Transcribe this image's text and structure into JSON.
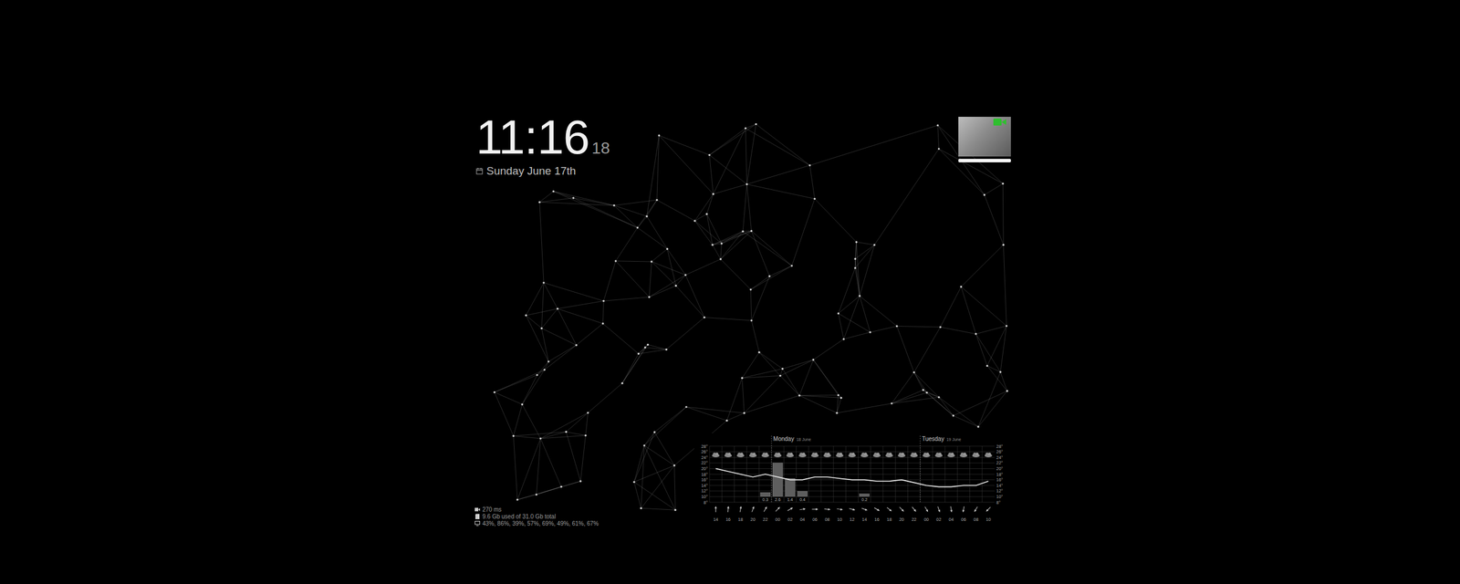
{
  "clock": {
    "time": "11:16",
    "seconds": "18",
    "date": "Sunday June 17th"
  },
  "camera": {
    "recording": true,
    "level": 1
  },
  "stats": [
    {
      "kind": "camera",
      "text": "270 ms"
    },
    {
      "kind": "storage",
      "text": "9.6 Gb used of 31.0 Gb total"
    },
    {
      "kind": "cpu",
      "text": "43%, 86%, 39%, 57%, 69%, 49%, 61%, 67%"
    }
  ],
  "weather": {
    "days": [
      {
        "name": "Monday",
        "date": "18 June"
      },
      {
        "name": "Tuesday",
        "date": "19 June"
      }
    ],
    "ticks": [
      "28°",
      "26°",
      "24°",
      "22°",
      "20°",
      "18°",
      "16°",
      "14°",
      "12°",
      "10°",
      "8°"
    ],
    "hours": [
      "14",
      "16",
      "18",
      "20",
      "22",
      "00",
      "02",
      "04",
      "06",
      "08",
      "10",
      "12",
      "14",
      "16",
      "18",
      "20",
      "22",
      "00",
      "02",
      "04",
      "06",
      "08",
      "10"
    ],
    "temperature": [
      20,
      19,
      18,
      17,
      18,
      17,
      16,
      16,
      17,
      17,
      16.5,
      16,
      16,
      15.5,
      15.5,
      16,
      15,
      14,
      13.5,
      13.5,
      14,
      14,
      15.5
    ],
    "precipitation": [
      0,
      0,
      0,
      0,
      0.3,
      2.6,
      1.4,
      0.4,
      0,
      0,
      0,
      0,
      0.2,
      0,
      0,
      0,
      0,
      0,
      0,
      0,
      0,
      0,
      0
    ],
    "precipitation_labels": [
      "",
      "",
      "",
      "",
      "0.3",
      "2.6",
      "1.4",
      "0.4",
      "",
      "",
      "",
      "",
      "0.2",
      "",
      "",
      "",
      "",
      "",
      "",
      "",
      "",
      "",
      ""
    ],
    "wind_directions": [
      180,
      185,
      190,
      200,
      210,
      225,
      240,
      260,
      270,
      275,
      280,
      285,
      290,
      300,
      310,
      315,
      320,
      330,
      340,
      350,
      10,
      30,
      45
    ]
  }
}
